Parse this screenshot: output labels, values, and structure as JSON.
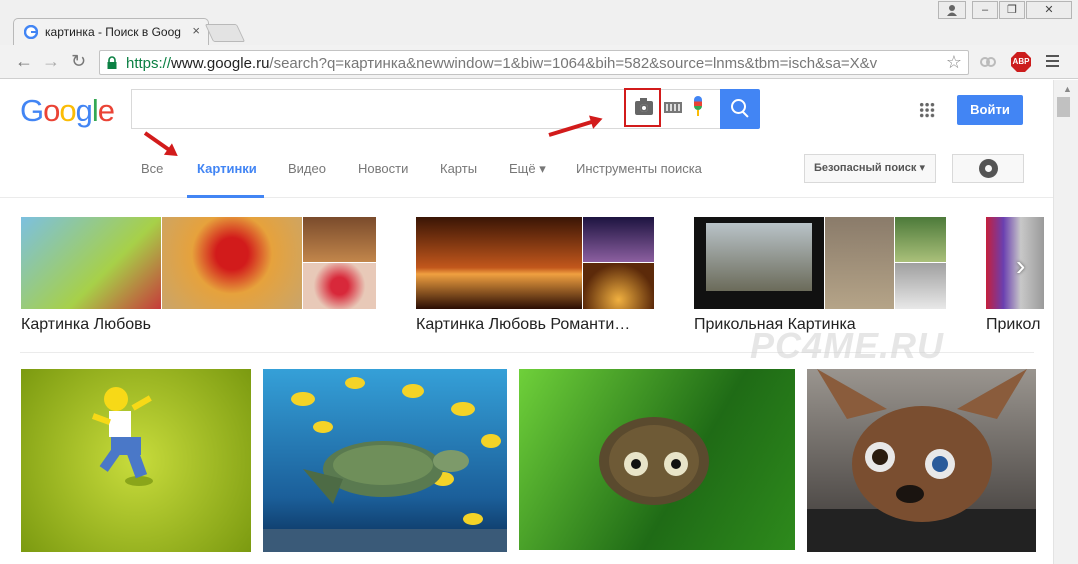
{
  "browser": {
    "tab_title": "картинка - Поиск в Goog",
    "tab_close": "×",
    "url_scheme": "https://",
    "url_host": "www.google.ru",
    "url_rest": "/search?q=картинка&newwindow=1&biw=1064&bih=582&source=lnms&tbm=isch&sa=X&v",
    "abp_label": "ABP",
    "window_buttons": [
      "‒",
      "❐",
      "✕"
    ]
  },
  "google": {
    "logo_letters": [
      "G",
      "o",
      "o",
      "g",
      "l",
      "e"
    ],
    "logo_colors": [
      "#4285f4",
      "#ea4335",
      "#fbbc05",
      "#4285f4",
      "#34a853",
      "#ea4335"
    ],
    "search_value": "",
    "login_label": "Войти"
  },
  "nav": {
    "tabs": [
      "Все",
      "Картинки",
      "Видео",
      "Новости",
      "Карты",
      "Ещё ▾",
      "Инструменты поиска"
    ],
    "active_tab": "Картинки",
    "safe_search_label": "Безопасный поиск ▾"
  },
  "related": [
    {
      "label": "Картинка Любовь",
      "colors": [
        "#c63b3b",
        "#e6a23c",
        "#a7b84e",
        "#d8523a"
      ]
    },
    {
      "label": "Картинка Любовь Романти…",
      "colors": [
        "#c2571c",
        "#3f2a5c",
        "#e08c3a"
      ]
    },
    {
      "label": "Прикольная Картинка",
      "colors": [
        "#6b6b6b",
        "#8c7b63",
        "#4d7a3a",
        "#9b9b9b"
      ]
    },
    {
      "label": "Прикол",
      "colors": [
        "#c41f3c",
        "#8a8a8a"
      ]
    }
  ],
  "results": [
    {
      "name": "homer",
      "colors": [
        "#a8c22a",
        "#7b9a10"
      ]
    },
    {
      "name": "turtle",
      "colors": [
        "#2d74b3",
        "#0a3d6b"
      ]
    },
    {
      "name": "fuzzy-creature",
      "colors": [
        "#3c9a27",
        "#1e5e16"
      ]
    },
    {
      "name": "chihuahua",
      "colors": [
        "#6d4a33",
        "#2e2a28"
      ]
    }
  ],
  "watermark": "PC4ME.RU",
  "colors": {
    "accent": "#4285f4",
    "annotation_red": "#d21b1b"
  }
}
